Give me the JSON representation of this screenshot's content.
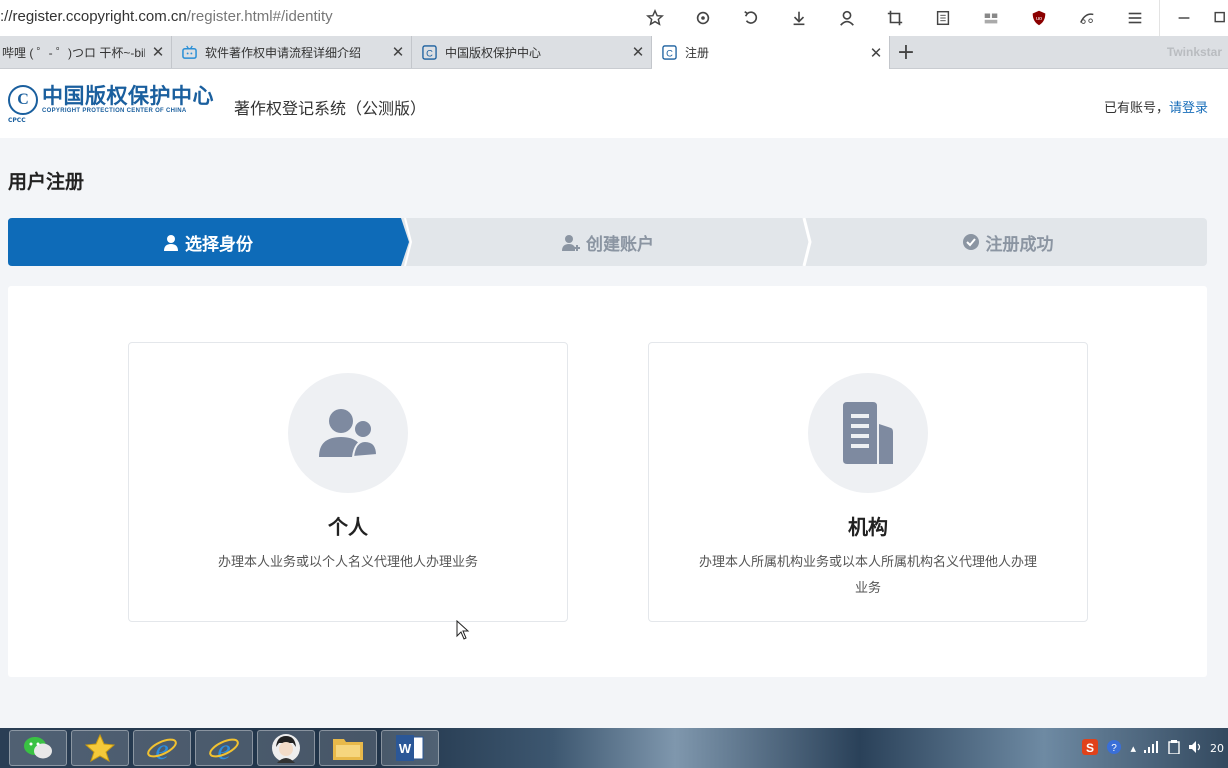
{
  "browser": {
    "url_host": "://register.ccopyright.com.cn",
    "url_path": "/register.html#/identity",
    "tabs": [
      {
        "title": "哔哩 ( ゜- ゜)つロ 干杯~-bilibili",
        "active": false
      },
      {
        "title": "软件著作权申请流程详细介绍",
        "active": false
      },
      {
        "title": "中国版权保护中心",
        "active": false
      },
      {
        "title": "注册",
        "active": true
      }
    ],
    "corner_label": "Twinkstar"
  },
  "header": {
    "logo_cn": "中国版权保护中心",
    "logo_en": "COPYRIGHT PROTECTION CENTER OF CHINA",
    "logo_mark": "C",
    "logo_abbr": "CPCC",
    "system_name": "著作权登记系统（公测版）",
    "has_account_text": "已有账号，",
    "login_link": "请登录"
  },
  "page": {
    "title": "用户注册",
    "steps": [
      {
        "label": "选择身份",
        "active": true
      },
      {
        "label": "创建账户",
        "active": false
      },
      {
        "label": "注册成功",
        "active": false
      }
    ],
    "cards": [
      {
        "title": "个人",
        "desc": "办理本人业务或以个人名义代理他人办理业务",
        "icon": "users-icon"
      },
      {
        "title": "机构",
        "desc": "办理本人所属机构业务或以本人所属机构名义代理他人办理业务",
        "icon": "building-icon"
      }
    ]
  },
  "taskbar": {
    "clock": "20"
  },
  "colors": {
    "primary": "#0e6bb8",
    "step_inactive": "#e2e6ea",
    "icon_gray": "#7e8aa0"
  }
}
